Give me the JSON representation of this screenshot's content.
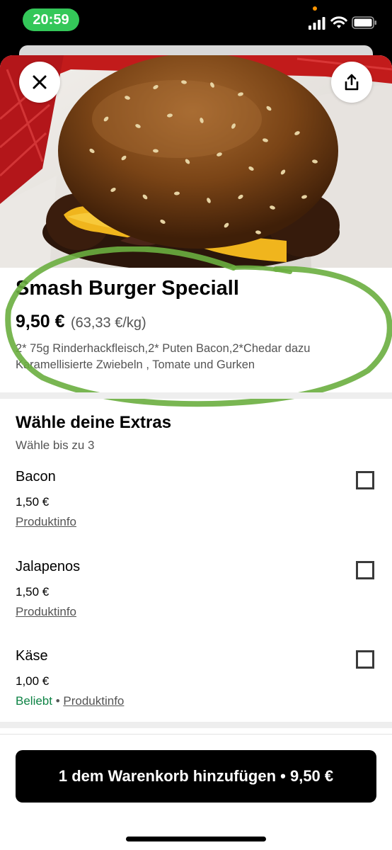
{
  "status_bar": {
    "time": "20:59",
    "colors": {
      "time_pill": "#34c759",
      "privacy_dot": "#ff9500"
    },
    "icons": [
      "signal-icon",
      "wifi-icon",
      "battery-icon"
    ]
  },
  "header": {
    "image": "smash-burger-photo",
    "close_icon": "close-icon",
    "share_icon": "share-icon"
  },
  "product": {
    "title": "Smash Burger Speciall",
    "price": "9,50 €",
    "unit_price": "(63,33 €/kg)",
    "description": "2* 75g Rinderhackfleisch,2* Puten Bacon,2*Chedar dazu Karamellisierte Zwiebeln , Tomate und Gurken"
  },
  "extras": {
    "title": "Wähle deine Extras",
    "subtitle": "Wähle bis zu 3",
    "options": [
      {
        "name": "Bacon",
        "price": "1,50 €",
        "badge": "",
        "info": "Produktinfo",
        "checked": false
      },
      {
        "name": "Jalapenos",
        "price": "1,50 €",
        "badge": "",
        "info": "Produktinfo",
        "checked": false
      },
      {
        "name": "Käse",
        "price": "1,00 €",
        "badge": "Beliebt",
        "separator": " • ",
        "info": "Produktinfo",
        "checked": false
      }
    ]
  },
  "cart_button": {
    "label": "1 dem Warenkorb hinzufügen • 9,50 €"
  },
  "colors": {
    "accent_green": "#0e8345",
    "annotation_stroke": "#6aae3f",
    "button_bg": "#000000"
  }
}
